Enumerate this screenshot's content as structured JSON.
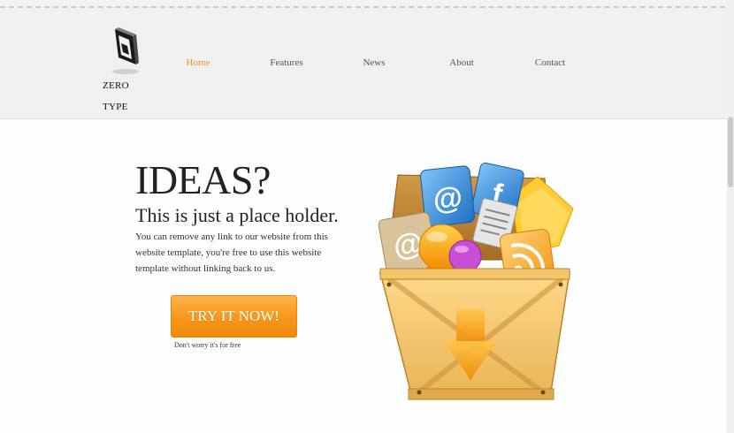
{
  "brand": {
    "line1": "ZERO",
    "line2": "TYPE"
  },
  "nav": [
    {
      "label": "Home",
      "active": true
    },
    {
      "label": "Features",
      "active": false
    },
    {
      "label": "News",
      "active": false
    },
    {
      "label": "About",
      "active": false
    },
    {
      "label": "Contact",
      "active": false
    }
  ],
  "hero": {
    "title": "IDEAS?",
    "subtitle": "This is just a place holder.",
    "description": "You can remove any link to our website from this website template, you're free to use this website template without linking back to us.",
    "cta_label": "TRY IT NOW!",
    "cta_note": "Don't worry it's for free"
  },
  "illustration": {
    "items": [
      "email-at-icon",
      "facebook-icon",
      "chat-bubble-icon",
      "rss-icon",
      "folder-icon",
      "document-icon",
      "download-arrow-icon"
    ]
  },
  "colors": {
    "accent": "#f0901a",
    "header_bg": "#f0f0f0",
    "button_top": "#ffb347",
    "button_bottom": "#f08a0c"
  }
}
